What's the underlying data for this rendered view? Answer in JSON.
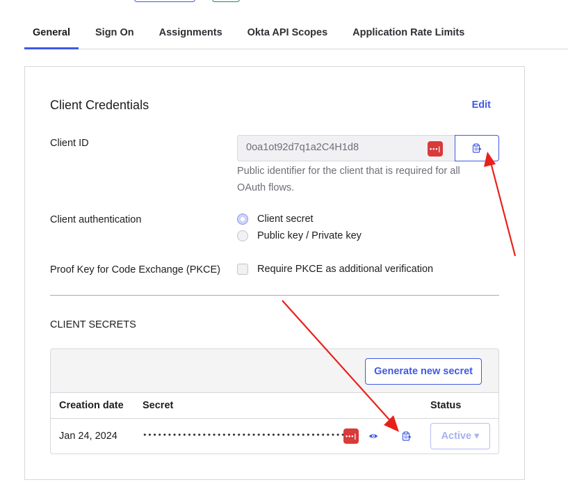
{
  "tabs": [
    "General",
    "Sign On",
    "Assignments",
    "Okta API Scopes",
    "Application Rate Limits"
  ],
  "credentials": {
    "title": "Client Credentials",
    "edit_label": "Edit",
    "client_id_label": "Client ID",
    "client_id_value": "0oa1ot92d7q1a2C4H1d8",
    "password_badge": "•••|",
    "client_id_help": "Public identifier for the client that is required for all OAuth flows.",
    "auth_label": "Client authentication",
    "auth_options": [
      "Client secret",
      "Public key / Private key"
    ],
    "auth_selected": "Client secret",
    "pkce_label": "Proof Key for Code Exchange (PKCE)",
    "pkce_option": "Require PKCE as additional verification",
    "pkce_checked": false
  },
  "secrets": {
    "heading": "CLIENT SECRETS",
    "generate_label": "Generate new secret",
    "columns": [
      "Creation date",
      "Secret",
      "Status"
    ],
    "rows": [
      {
        "date": "Jan 24, 2024",
        "secret_mask": "•••••••••••••••••••••••••••••••••••••••••••••••••••••••••••",
        "status": "Active ▾"
      }
    ]
  },
  "colors": {
    "accent": "#3f59e4",
    "password_manager": "#d93a3a",
    "arrow": "#e8201a"
  },
  "icons": [
    "clipboard-copy-icon",
    "password-manager-icon",
    "eye-icon",
    "chevron-down-icon"
  ]
}
